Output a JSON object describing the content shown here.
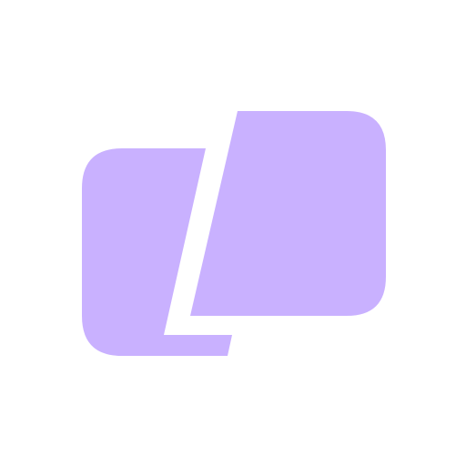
{
  "logo": {
    "icon": "split-chat-bubbles-icon",
    "colors": {
      "background": "#ffffff",
      "shape": "#c9b1ff"
    }
  }
}
